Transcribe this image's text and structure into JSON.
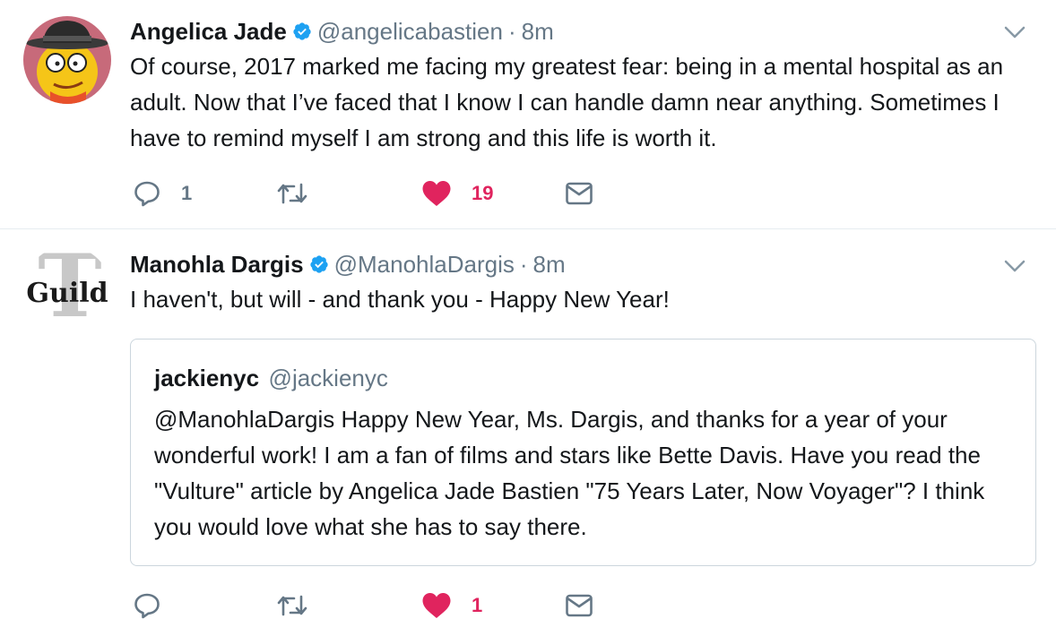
{
  "colors": {
    "text": "#14171a",
    "secondary": "#657786",
    "like": "#e0245e",
    "verified": "#1da1f2",
    "border": "#e6ecf0"
  },
  "tweets": [
    {
      "author": {
        "name": "Angelica Jade",
        "handle": "@angelicabastien",
        "verified": true,
        "avatar_icon": "cartoon-character-fedora-avatar"
      },
      "separator": "·",
      "time": "8m",
      "text": "Of course, 2017 marked me facing my greatest fear: being in a mental hospital as an adult. Now that I’ve faced that I know I can handle damn near anything. Sometimes I have to remind myself I am strong and this life is worth it.",
      "actions": {
        "reply_count": "1",
        "retweet_count": "",
        "like_count": "19",
        "liked": true
      }
    },
    {
      "author": {
        "name": "Manohla Dargis",
        "handle": "@ManohlaDargis",
        "verified": true,
        "avatar_icon": "guild-logo-avatar",
        "avatar_text": "Guild"
      },
      "separator": "·",
      "time": "8m",
      "text": "I haven't, but will - and thank you - Happy New Year!",
      "quote": {
        "name": "jackienyc",
        "handle": "@jackienyc",
        "text": "@ManohlaDargis Happy New Year, Ms. Dargis, and thanks for a year of your wonderful work! I am a fan of films and stars like Bette Davis. Have you read the \"Vulture\" article by Angelica Jade Bastien \"75 Years Later, Now Voyager\"? I think you would love what she has to say there."
      },
      "actions": {
        "reply_count": "",
        "retweet_count": "",
        "like_count": "1",
        "liked": true
      }
    }
  ]
}
